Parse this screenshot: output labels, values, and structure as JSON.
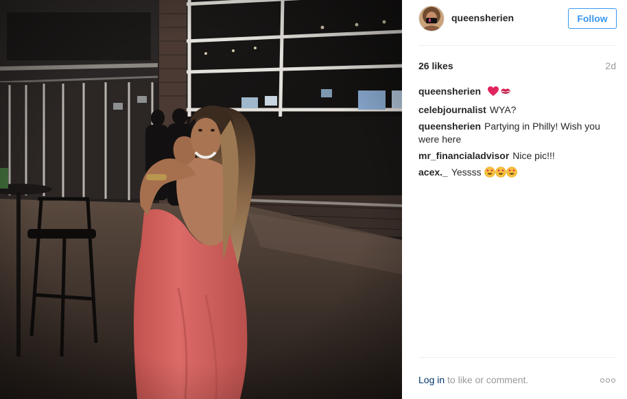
{
  "post": {
    "author": "queensherien",
    "follow_label": "Follow",
    "likes": "26 likes",
    "age": "2d"
  },
  "comments": [
    {
      "author": "queensherien",
      "text": "",
      "emoji": [
        "red-heart-icon",
        "kiss-mark-icon"
      ]
    },
    {
      "author": "celebjournalist",
      "text": "WYA?"
    },
    {
      "author": "queensherien",
      "text": "Partying in Philly! Wish you were here"
    },
    {
      "author": "mr_financialadvisor",
      "text": "Nice pic!!!"
    },
    {
      "author": "acex._",
      "text": "Yessss",
      "emoji": [
        "heart-eyes-icon",
        "heart-eyes-icon",
        "heart-eyes-icon"
      ]
    }
  ],
  "footer": {
    "login_link": "Log in",
    "login_suffix": "to like or comment."
  },
  "colors": {
    "accent": "#3897f0",
    "link": "#003569",
    "muted": "#999999",
    "text": "#262626",
    "dress": "#d9605e"
  },
  "icons": {
    "more": "more-options-icon",
    "avatar": "avatar"
  }
}
